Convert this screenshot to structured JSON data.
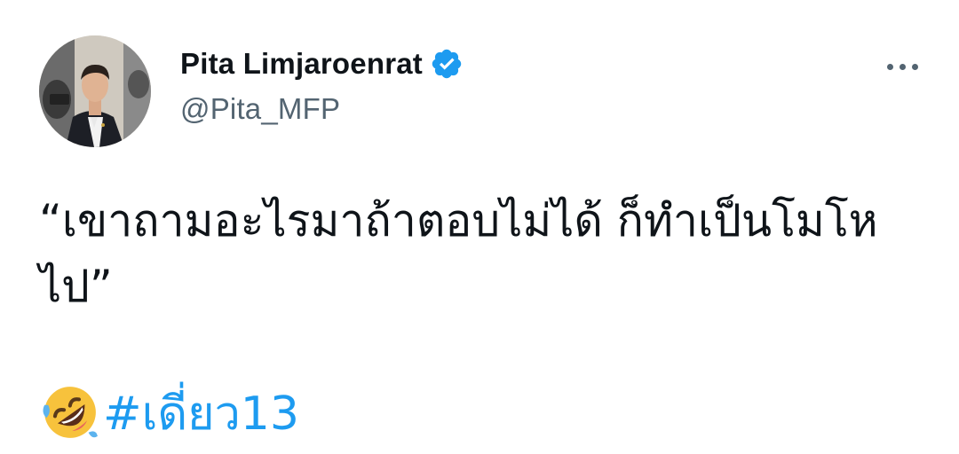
{
  "author": {
    "display_name": "Pita Limjaroenrat",
    "handle": "@Pita_MFP",
    "verified": true
  },
  "icons": {
    "verified": "verified-badge-icon",
    "more": "more-options-icon",
    "emoji": "rolling-on-floor-laughing-emoji"
  },
  "tweet": {
    "text": "“เขาถามอะไรมาถ้าตอบไม่ได้ ก็ทำเป็นโมโหไป”",
    "hashtag": "#เดี่ยว13"
  },
  "colors": {
    "link": "#1d9bf0",
    "text": "#0f1419",
    "secondary": "#536471"
  }
}
